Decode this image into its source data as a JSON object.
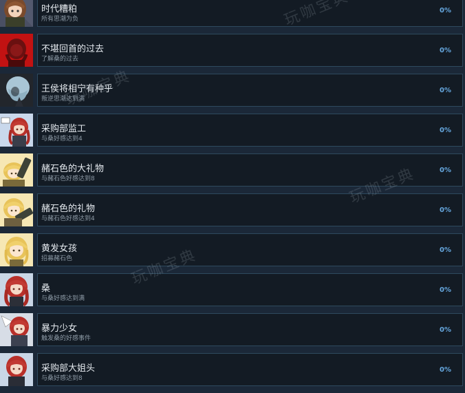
{
  "watermark": "玩咖宝典",
  "colors": {
    "background": "#1b2838",
    "panel": "#131b24",
    "panel_border": "#2e4a5e",
    "title": "#e4e9ee",
    "description": "#8b98a4",
    "percent": "#66a8e0"
  },
  "achievements": [
    {
      "title": "时代糟粕",
      "description": "所有思潮为负",
      "percent": "0%",
      "avatar_icon": "brown-hair-girl-avatar-icon"
    },
    {
      "title": "不堪回首的过去",
      "description": "了解桑的过去",
      "percent": "0%",
      "avatar_icon": "red-hair-silhouette-avatar-icon"
    },
    {
      "title": "王侯将相宁有种乎",
      "description": "叛逆思潮达到满",
      "percent": "0%",
      "avatar_icon": "silver-hair-avatar-icon"
    },
    {
      "title": "采购部监工",
      "description": "与桑好感达到4",
      "percent": "0%",
      "avatar_icon": "red-hair-girl-avatar-icon"
    },
    {
      "title": "赭石色的大礼物",
      "description": "与赭石色好感达到8",
      "percent": "0%",
      "avatar_icon": "blonde-girl-gift-avatar-icon"
    },
    {
      "title": "赭石色的礼物",
      "description": "与赭石色好感达到4",
      "percent": "0%",
      "avatar_icon": "blonde-girl-gift-avatar-icon"
    },
    {
      "title": "黄发女孩",
      "description": "招募赭石色",
      "percent": "0%",
      "avatar_icon": "blonde-girl-avatar-icon"
    },
    {
      "title": "桑",
      "description": "与桑好感达到满",
      "percent": "0%",
      "avatar_icon": "red-hair-girl-avatar-icon"
    },
    {
      "title": "暴力少女",
      "description": "触发桑的好感事件",
      "percent": "0%",
      "avatar_icon": "red-hair-girl-avatar-icon"
    },
    {
      "title": "采购部大姐头",
      "description": "与桑好感达到8",
      "percent": "0%",
      "avatar_icon": "red-hair-girl-avatar-icon"
    }
  ]
}
